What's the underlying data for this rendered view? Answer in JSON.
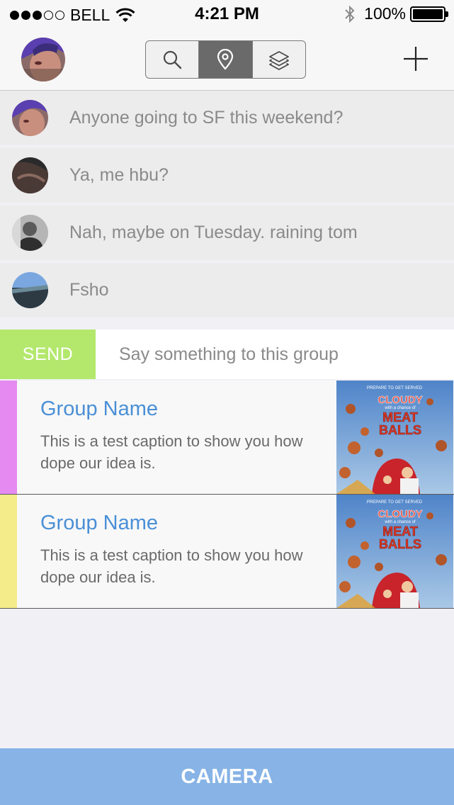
{
  "status_bar": {
    "carrier": "BELL",
    "time": "4:21 PM",
    "battery": "100%",
    "signal_bars_filled": 3,
    "signal_bars_total": 5
  },
  "nav": {
    "tabs": [
      {
        "icon": "search-icon",
        "active": false
      },
      {
        "icon": "location-pin-icon",
        "active": true
      },
      {
        "icon": "layers-icon",
        "active": false
      }
    ]
  },
  "messages": [
    {
      "text": "Anyone going to SF this weekend?"
    },
    {
      "text": "Ya, me hbu?"
    },
    {
      "text": "Nah, maybe on Tuesday. raining tom"
    },
    {
      "text": "Fsho"
    }
  ],
  "composer": {
    "send_label": "SEND",
    "placeholder": "Say something to this group"
  },
  "groups": [
    {
      "name": "Group Name",
      "caption": "This is a test caption to show you how dope our idea is.",
      "accent": "#e58af0"
    },
    {
      "name": "Group Name",
      "caption": "This is a test caption to show you how dope our idea is.",
      "accent": "#f4ec8a"
    }
  ],
  "thumb": {
    "tagline": "PREPARE TO GET SERVED",
    "line1": "CLOUDY",
    "line2": "with a chance of",
    "line3": "MEAT",
    "line4": "BALLS"
  },
  "camera_label": "CAMERA",
  "colors": {
    "send": "#b3e86d",
    "camera": "#87b3e6",
    "group_name": "#4a8fd6"
  }
}
